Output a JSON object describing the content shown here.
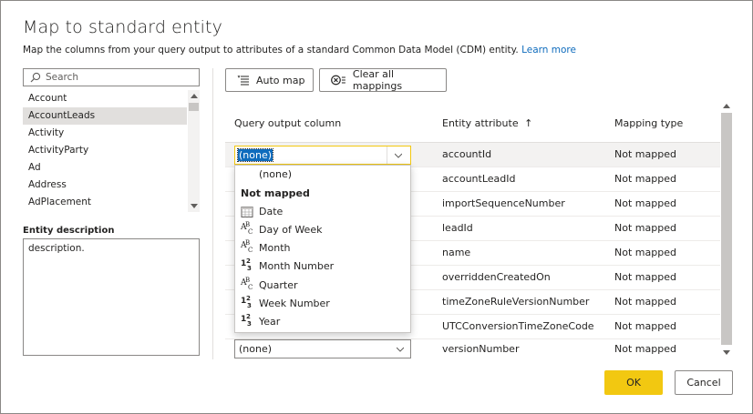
{
  "dialog": {
    "title": "Map to standard entity",
    "subtitle": "Map the columns from your query output to attributes of a standard Common Data Model (CDM) entity.",
    "learn_more": "Learn more"
  },
  "search": {
    "placeholder": "Search",
    "value": ""
  },
  "entities": [
    "Account",
    "AccountLeads",
    "Activity",
    "ActivityParty",
    "Ad",
    "Address",
    "AdPlacement"
  ],
  "selected_entity": "AccountLeads",
  "entity_description": {
    "label": "Entity description",
    "text": "description."
  },
  "toolbar": {
    "auto_map": "Auto map",
    "clear_all": "Clear all mappings"
  },
  "table": {
    "headers": {
      "query": "Query output column",
      "attribute": "Entity attribute",
      "sort_indicator": "↑",
      "mapping": "Mapping type"
    },
    "rows": [
      {
        "query": "(none)",
        "attribute": "accountId",
        "mapping": "Not mapped"
      },
      {
        "query": "",
        "attribute": "accountLeadId",
        "mapping": "Not mapped"
      },
      {
        "query": "",
        "attribute": "importSequenceNumber",
        "mapping": "Not mapped"
      },
      {
        "query": "",
        "attribute": "leadId",
        "mapping": "Not mapped"
      },
      {
        "query": "",
        "attribute": "name",
        "mapping": "Not mapped"
      },
      {
        "query": "",
        "attribute": "overriddenCreatedOn",
        "mapping": "Not mapped"
      },
      {
        "query": "",
        "attribute": "timeZoneRuleVersionNumber",
        "mapping": "Not mapped"
      },
      {
        "query": "",
        "attribute": "UTCConversionTimeZoneCode",
        "mapping": "Not mapped"
      },
      {
        "query": "(none)",
        "attribute": "versionNumber",
        "mapping": "Not mapped"
      }
    ]
  },
  "dropdown": {
    "none_option": "(none)",
    "group_header": "Not mapped",
    "options": [
      {
        "label": "Date",
        "icon": "calendar-icon"
      },
      {
        "label": "Day of Week",
        "icon": "text-type-icon"
      },
      {
        "label": "Month",
        "icon": "text-type-icon"
      },
      {
        "label": "Month Number",
        "icon": "number-type-icon"
      },
      {
        "label": "Quarter",
        "icon": "text-type-icon"
      },
      {
        "label": "Week Number",
        "icon": "number-type-icon"
      },
      {
        "label": "Year",
        "icon": "number-type-icon"
      }
    ]
  },
  "footer": {
    "ok": "OK",
    "cancel": "Cancel"
  },
  "colors": {
    "accent": "#f2c811",
    "link": "#0f6cbd",
    "selection": "#0f6cbd"
  }
}
